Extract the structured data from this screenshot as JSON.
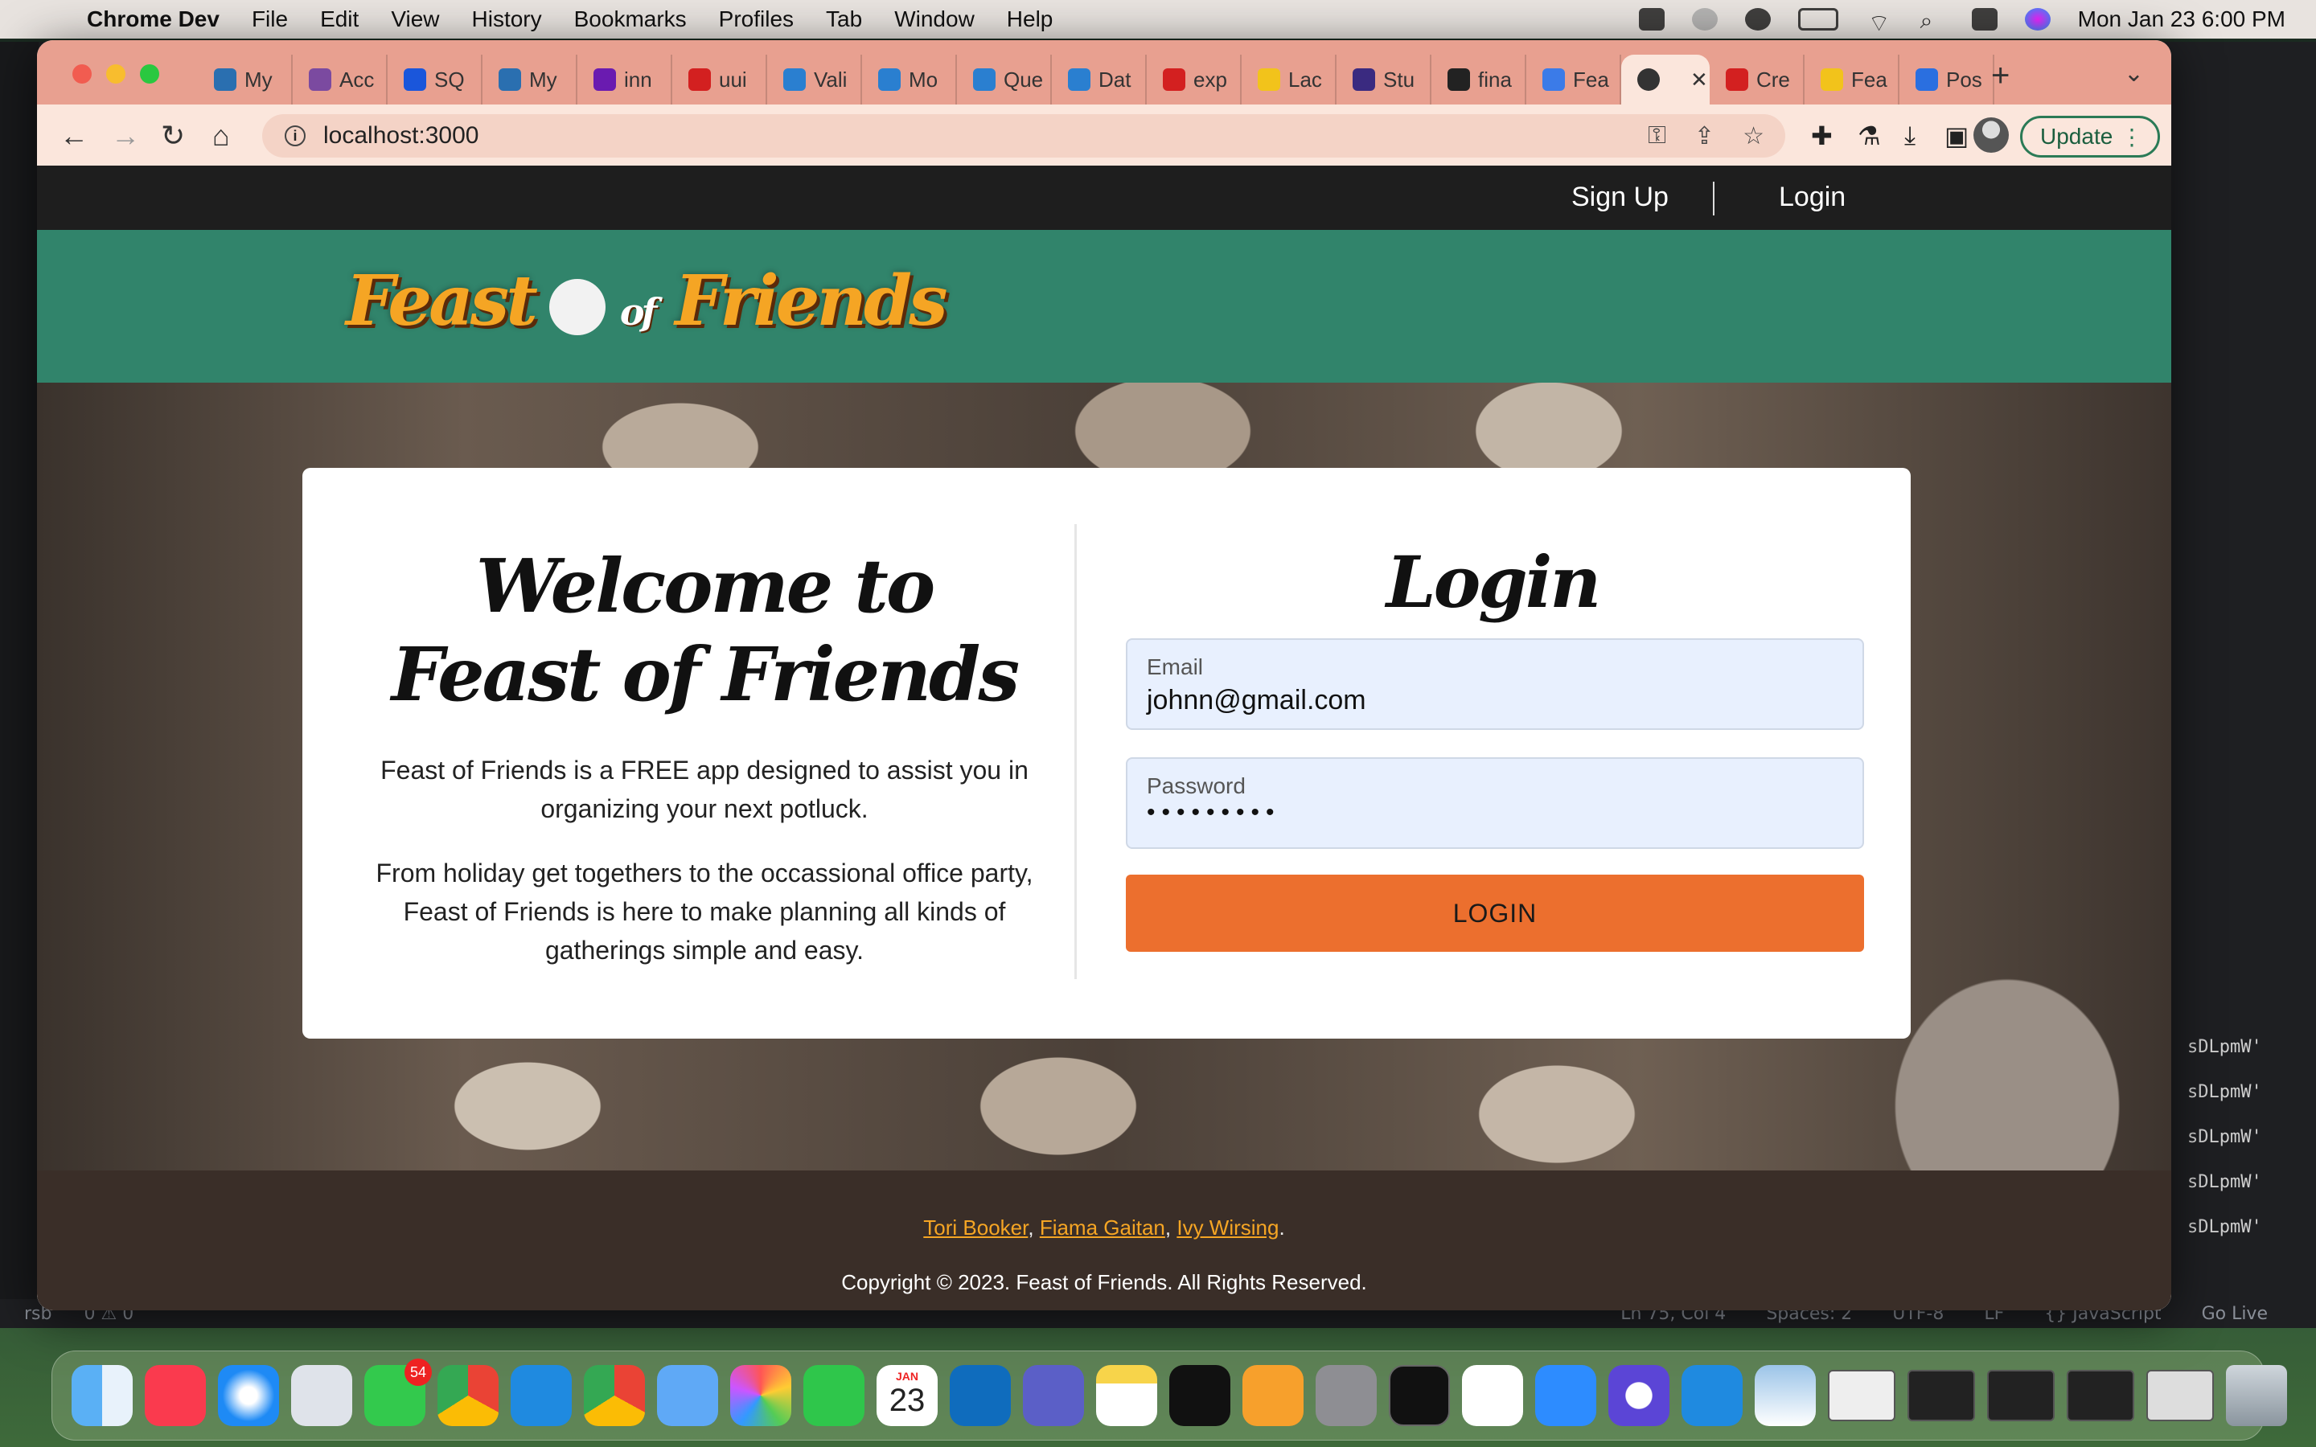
{
  "menubar": {
    "app_name": "Chrome Dev",
    "items": [
      "File",
      "Edit",
      "View",
      "History",
      "Bookmarks",
      "Profiles",
      "Tab",
      "Window",
      "Help"
    ],
    "clock": "Mon Jan 23  6:00 PM"
  },
  "tabs": [
    {
      "label": "My",
      "color": "#2a6fb0"
    },
    {
      "label": "Acc",
      "color": "#7b4aa0"
    },
    {
      "label": "SQ",
      "color": "#1a56db"
    },
    {
      "label": "My",
      "color": "#2a6fb0"
    },
    {
      "label": "inn",
      "color": "#6a1bb0"
    },
    {
      "label": "uui",
      "color": "#d32020"
    },
    {
      "label": "Vali",
      "color": "#2a7fd0"
    },
    {
      "label": "Mo",
      "color": "#2a7fd0"
    },
    {
      "label": "Que",
      "color": "#2a7fd0"
    },
    {
      "label": "Dat",
      "color": "#2a7fd0"
    },
    {
      "label": "exp",
      "color": "#d32020"
    },
    {
      "label": "Lac",
      "color": "#f2c31b"
    },
    {
      "label": "Stu",
      "color": "#3a2a80"
    },
    {
      "label": "fina",
      "color": "#222222"
    },
    {
      "label": "Fea",
      "color": "#3b7be8"
    },
    {
      "label": "",
      "color": "#333333",
      "active": true
    },
    {
      "label": "Cre",
      "color": "#d32020"
    },
    {
      "label": "Fea",
      "color": "#f2c31b"
    },
    {
      "label": "Pos",
      "color": "#2a6fe0"
    }
  ],
  "browser": {
    "url": "localhost:3000",
    "update_label": "Update"
  },
  "page": {
    "nav": {
      "signup": "Sign Up",
      "login": "Login"
    },
    "logo": {
      "part1": "Feast",
      "of": "of",
      "part2": "Friends"
    },
    "welcome": {
      "line1": "Welcome to",
      "line2": "Feast of Friends"
    },
    "description1": "Feast of Friends is a FREE app designed to assist you in organizing your next potluck.",
    "description2": "From holiday get togethers to the occassional office party, Feast of Friends is here to make planning all kinds of gatherings simple and easy.",
    "login_form": {
      "heading": "Login",
      "email_label": "Email",
      "email_value": "johnn@gmail.com",
      "password_label": "Password",
      "password_value": "•••••••••",
      "button": "LOGIN"
    },
    "footer": {
      "credits": [
        "Tori Booker",
        "Fiama Gaitan",
        "Ivy Wirsing"
      ],
      "copyright": "Copyright © 2023. Feast of Friends. All Rights Reserved."
    }
  },
  "vscode": {
    "status": {
      "branch": "rsb",
      "problems": "0 ⚠ 0",
      "position": "Ln 75, Col 4",
      "spaces": "Spaces: 2",
      "encoding": "UTF-8",
      "eol": "LF",
      "language": "{} JavaScript",
      "golive": "Go Live"
    },
    "terminal_lines": [
      "sDLpmW'",
      "sDLpmW'",
      "sDLpmW'",
      "sDLpmW'",
      "sDLpmW'"
    ]
  },
  "dock": {
    "messages_badge": "54",
    "calendar_month": "JAN",
    "calendar_day": "23"
  },
  "colors": {
    "brand_green": "#31846b",
    "login_orange": "#ec6f2e",
    "footer_brown": "#3a2e28",
    "accent_gold": "#f5a524"
  }
}
